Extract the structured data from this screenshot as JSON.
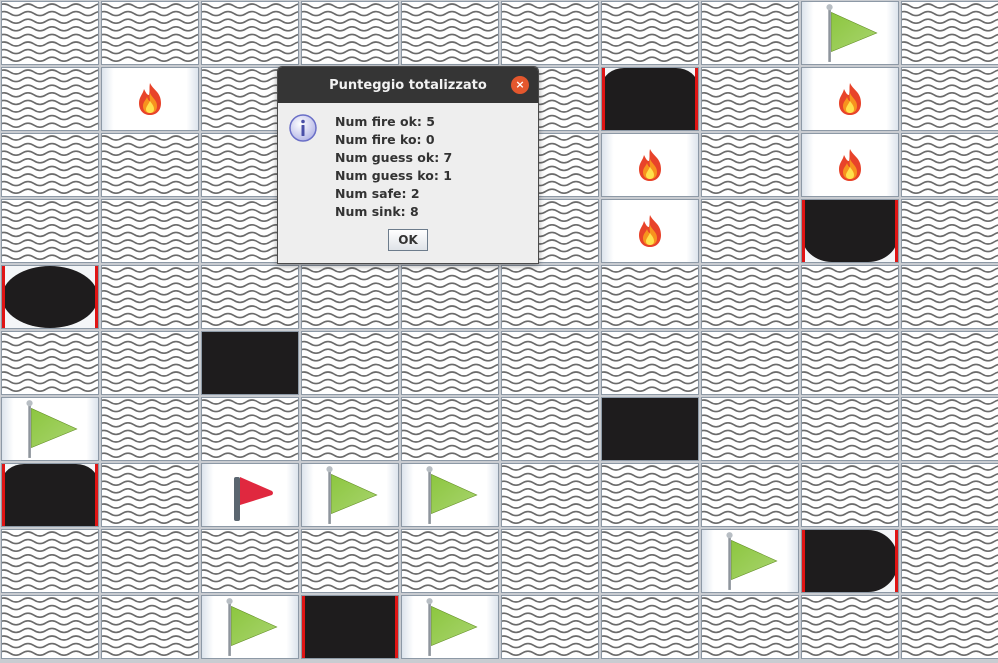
{
  "board": {
    "rows": [
      [
        "water",
        "water",
        "water",
        "water",
        "water",
        "water",
        "water",
        "water",
        "flag",
        "water"
      ],
      [
        "water",
        "fire",
        "water",
        "water",
        "water",
        "water",
        "ship-sunk",
        "water",
        "fire",
        "water"
      ],
      [
        "water",
        "water",
        "water",
        "water",
        "water",
        "water",
        "fire",
        "water",
        "fire",
        "water"
      ],
      [
        "water",
        "water",
        "water",
        "water",
        "water",
        "water",
        "fire",
        "water",
        "ship-sunk-bottom",
        "water"
      ],
      [
        "ship-sunk-round",
        "water",
        "water",
        "water",
        "water",
        "water",
        "water",
        "water",
        "water",
        "water"
      ],
      [
        "water",
        "water",
        "ship-square",
        "water",
        "water",
        "water",
        "water",
        "water",
        "water",
        "water"
      ],
      [
        "flag",
        "water",
        "water",
        "water",
        "water",
        "water",
        "ship-square",
        "water",
        "water",
        "water"
      ],
      [
        "ship-sunk",
        "water",
        "red-flag",
        "flag",
        "flag",
        "water",
        "water",
        "water",
        "water",
        "water"
      ],
      [
        "water",
        "water",
        "water",
        "water",
        "water",
        "water",
        "water",
        "flag",
        "ship-sunk-right",
        "water"
      ],
      [
        "water",
        "water",
        "flag",
        "ship-square-red",
        "flag",
        "water",
        "water",
        "water",
        "water",
        "water"
      ]
    ],
    "icon_names": {
      "water": "wave-icon",
      "fire": "fire-icon",
      "flag": "green-flag-icon",
      "red-flag": "red-flag-icon",
      "ship": "ship-icon"
    }
  },
  "dialog": {
    "title": "Punteggio totalizzato",
    "close_symbol": "×",
    "lines": [
      "Num fire ok: 5",
      "Num fire ko: 0",
      "Num guess ok: 7",
      "Num guess ko: 1",
      "Num safe: 2",
      "Num sink: 8"
    ],
    "ok_label": "OK",
    "icon": "info-icon"
  },
  "colors": {
    "dialog_title_bg": "#353535",
    "close_button": "#e4572d",
    "hit_border": "#e01515",
    "ship": "#1e1c1d",
    "flag_green": "#8cc63f",
    "flag_red": "#e0283f"
  }
}
